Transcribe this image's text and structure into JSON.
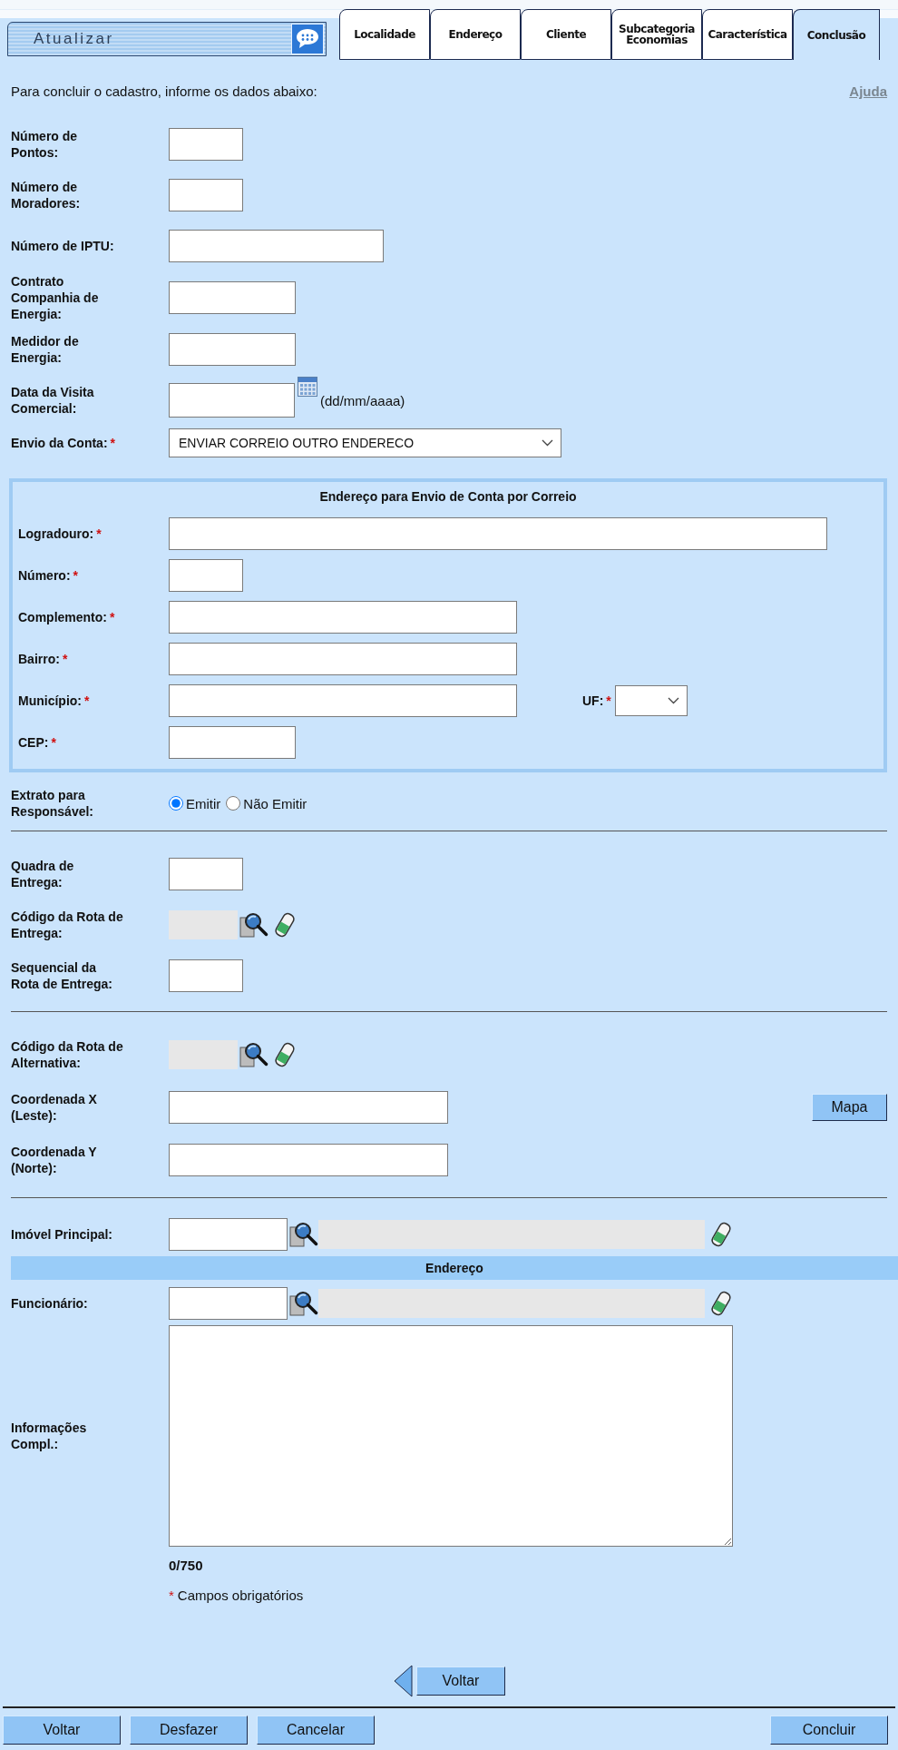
{
  "header": {
    "title": "Atualizar"
  },
  "tabs": [
    {
      "label": "Localidade",
      "selected": false
    },
    {
      "label": "Endereço",
      "selected": false
    },
    {
      "label": "Cliente",
      "selected": false
    },
    {
      "label": "Subcategoria Economias",
      "selected": false
    },
    {
      "label": "Característica",
      "selected": false
    },
    {
      "label": "Conclusão",
      "selected": true
    }
  ],
  "intro": "Para concluir o cadastro, informe os dados abaixo:",
  "help_link": "Ajuda",
  "required_mark": "*",
  "fields": [
    {
      "label": "Número de Pontos:",
      "kind": "short",
      "required": false
    },
    {
      "label": "Número de Moradores:",
      "kind": "short",
      "required": false
    },
    {
      "label": "Número de IPTU:",
      "kind": "long",
      "required": false
    },
    {
      "label": "Contrato Companhia de Energia:",
      "kind": "medium",
      "required": false
    },
    {
      "label": "Medidor de Energia:",
      "kind": "medium",
      "required": false
    },
    {
      "label": "Data da Visita Comercial:",
      "kind": "date",
      "required": false,
      "hint": "(dd/mm/aaaa)"
    },
    {
      "label": "Envio da Conta:",
      "kind": "select",
      "required": true,
      "value": "ENVIAR CORREIO OUTRO ENDERECO"
    }
  ],
  "mail_address": {
    "title": "Endereço para Envio de Conta por Correio",
    "fields": [
      {
        "label": "Logradouro:",
        "kind": "full",
        "required": true
      },
      {
        "label": "Número:",
        "kind": "short",
        "required": true
      },
      {
        "label": "Complemento:",
        "kind": "wide",
        "required": true
      },
      {
        "label": "Bairro:",
        "kind": "wide",
        "required": true
      },
      {
        "label": "Município:",
        "kind": "wide",
        "required": true,
        "uf": {
          "label": "UF:",
          "required": true
        }
      },
      {
        "label": "CEP:",
        "kind": "medium",
        "required": true
      }
    ]
  },
  "statement": {
    "label": "Extrato para Responsável:",
    "options": [
      {
        "label": "Emitir",
        "selected": true
      },
      {
        "label": "Não Emitir",
        "selected": false
      }
    ]
  },
  "delivery": [
    {
      "label": "Quadra de Entrega:",
      "kind": "short"
    },
    {
      "label": "Código da Rota de Entrega:",
      "kind": "lookup"
    },
    {
      "label": "Sequencial da Rota de Entrega:",
      "kind": "short"
    }
  ],
  "coordinates": [
    {
      "label": "Código da Rota de Alternativa:",
      "kind": "lookup"
    },
    {
      "label": "Coordenada X (Leste):",
      "kind": "coord",
      "button": "Mapa"
    },
    {
      "label": "Coordenada Y (Norte):",
      "kind": "coord"
    }
  ],
  "main_property": {
    "label": "Imóvel Principal:"
  },
  "address_band": "Endereço",
  "employee": {
    "label": "Funcionário:"
  },
  "notes": {
    "label": "Informações Compl.:",
    "counter": "0/750"
  },
  "required_note": "Campos obrigatórios",
  "back_button": "Voltar",
  "actions": [
    {
      "label": "Voltar"
    },
    {
      "label": "Desfazer"
    },
    {
      "label": "Cancelar"
    }
  ],
  "confirm_button": "Concluir"
}
